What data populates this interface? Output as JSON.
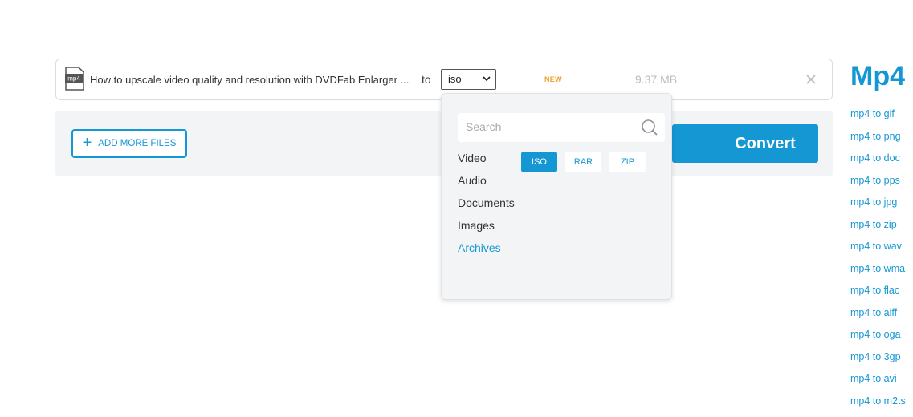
{
  "file": {
    "icon_label": "mp4",
    "name": "How to upscale video quality and resolution with DVDFab Enlarger ...",
    "to_label": "to",
    "selected_format": "iso",
    "badge": "NEW",
    "size": "9.37 MB"
  },
  "actions": {
    "add_more_label": "ADD MORE FILES",
    "convert_label": "Convert"
  },
  "dropdown": {
    "search_placeholder": "Search",
    "categories": [
      "Video",
      "Audio",
      "Documents",
      "Images",
      "Archives"
    ],
    "active_category": "Archives",
    "formats": [
      "ISO",
      "RAR",
      "ZIP"
    ],
    "selected_format": "ISO"
  },
  "sidebar": {
    "title": "Mp4",
    "links": [
      "mp4 to gif",
      "mp4 to png",
      "mp4 to doc",
      "mp4 to pps",
      "mp4 to jpg",
      "mp4 to zip",
      "mp4 to wav",
      "mp4 to wma",
      "mp4 to flac",
      "mp4 to aiff",
      "mp4 to oga",
      "mp4 to 3gp",
      "mp4 to avi",
      "mp4 to m2ts"
    ]
  },
  "colors": {
    "accent": "#1597d4",
    "badge": "#f0a030",
    "panel_bg": "#f2f4f5"
  }
}
